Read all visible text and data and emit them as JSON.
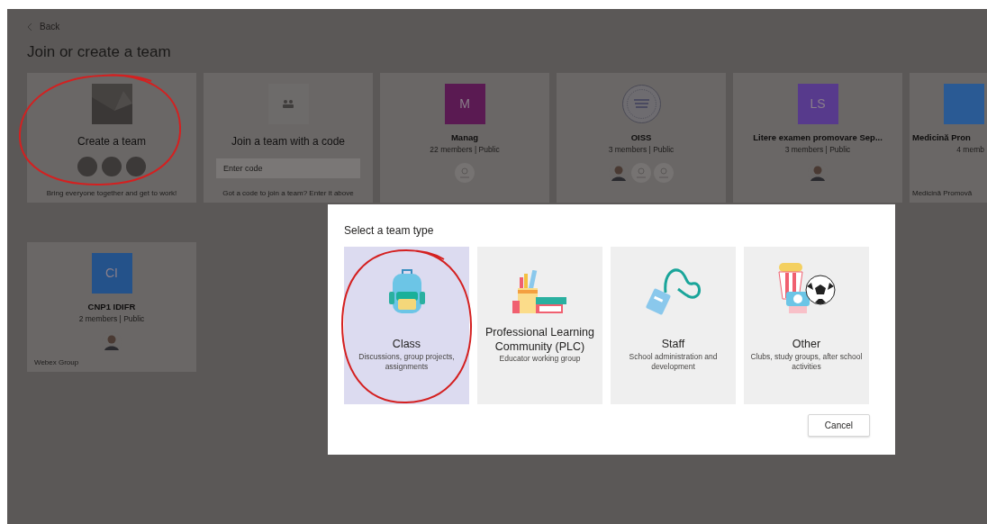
{
  "back": {
    "label": "Back"
  },
  "title": "Join or create a team",
  "cards": [
    {
      "kind": "create",
      "title": "Create a team",
      "description": "Bring everyone together and get to work!"
    },
    {
      "kind": "code",
      "title": "Join a team with a code",
      "placeholder": "Enter code",
      "description": "Got a code to join a team? Enter it above"
    },
    {
      "kind": "team",
      "initials": "M",
      "color": "#5a1a52",
      "name": "Manag",
      "meta": "22 members | Public",
      "avatars": [
        {
          "kind": "default"
        }
      ]
    },
    {
      "kind": "team",
      "seal": true,
      "name": "OISS",
      "meta": "3 members | Public",
      "avatars": [
        {
          "kind": "photo"
        },
        {
          "kind": "default"
        },
        {
          "kind": "default"
        }
      ]
    },
    {
      "kind": "team",
      "initials": "LS",
      "color": "#573a8c",
      "name": "Litere examen promovare Sep...",
      "meta": "3 members | Public",
      "avatars": [
        {
          "kind": "photo"
        }
      ]
    },
    {
      "kind": "team",
      "color": "#2a5a94",
      "name": "Medicină Pron",
      "meta": "4 memb",
      "description": "Medicină Promovă",
      "cut": true
    },
    {
      "kind": "team",
      "initials": "CI",
      "color": "#24528a",
      "name": "CNP1 IDIFR",
      "meta": "2 members | Public",
      "avatars": [
        {
          "kind": "photo"
        }
      ],
      "description": "Webex Group"
    }
  ],
  "dialog": {
    "title": "Select a team type",
    "types": [
      {
        "kind": "class",
        "title": "Class",
        "description": "Discussions, group projects, assignments",
        "selected": true
      },
      {
        "kind": "plc",
        "title": "Professional Learning Community (PLC)",
        "description": "Educator working group",
        "selected": false
      },
      {
        "kind": "staff",
        "title": "Staff",
        "description": "School administration and development",
        "selected": false
      },
      {
        "kind": "other",
        "title": "Other",
        "description": "Clubs, study groups, after school activities",
        "selected": false
      }
    ],
    "cancel": "Cancel"
  }
}
